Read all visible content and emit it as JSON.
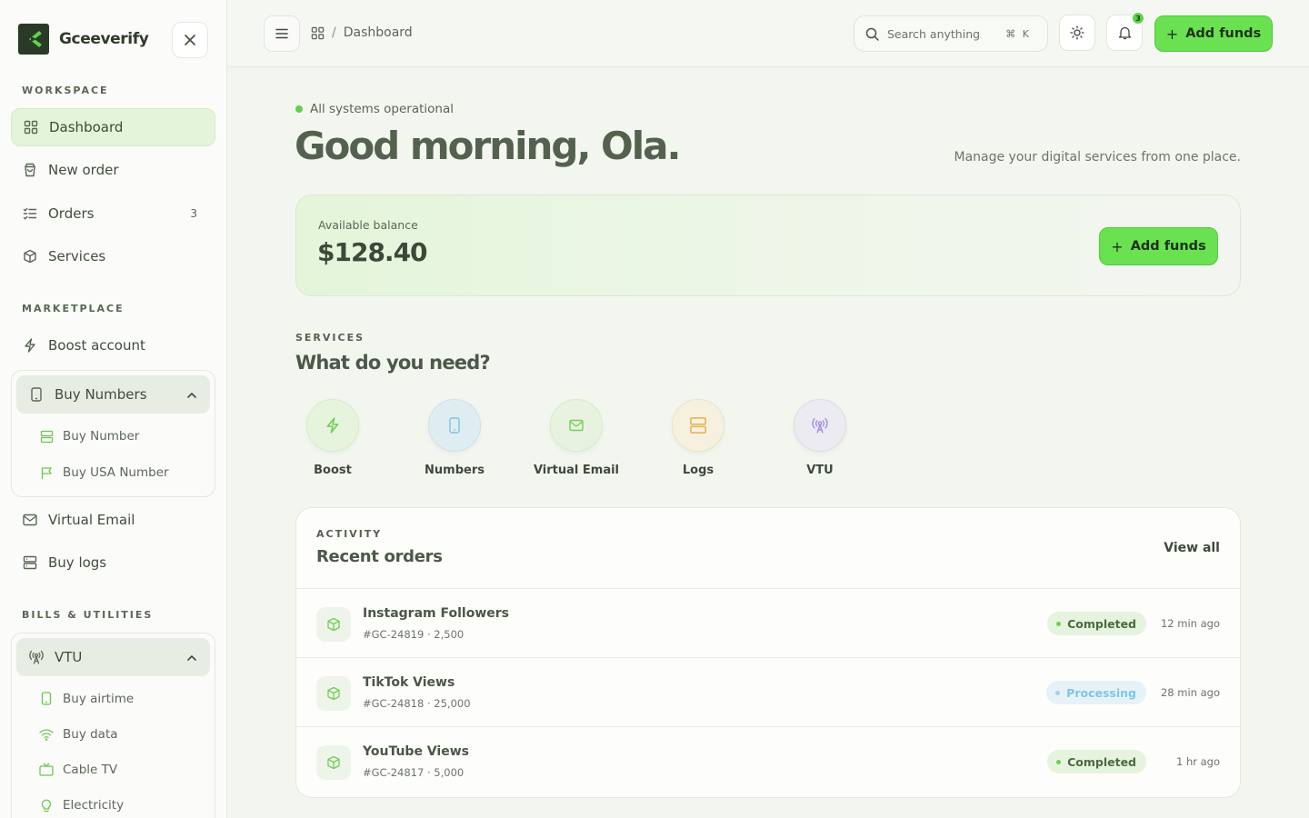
{
  "brand": {
    "name": "Gceeverify",
    "accent": "#6ae151",
    "dark": "#2a3a26"
  },
  "sidebar": {
    "sections": [
      {
        "label": "WORKSPACE"
      },
      {
        "label": "MARKETPLACE"
      },
      {
        "label": "BILLS & UTILITIES"
      }
    ],
    "workspace": [
      {
        "label": "Dashboard",
        "icon": "grid-icon",
        "active": true
      },
      {
        "label": "New order",
        "icon": "bag-icon"
      },
      {
        "label": "Orders",
        "icon": "list-check-icon",
        "count": "3"
      },
      {
        "label": "Services",
        "icon": "box-icon"
      }
    ],
    "marketplace": {
      "boost": {
        "label": "Boost account",
        "icon": "bolt-icon"
      },
      "buy_numbers": {
        "label": "Buy Numbers",
        "icon": "phone-icon",
        "expanded": true,
        "children": [
          {
            "label": "Buy Number",
            "icon": "server-icon"
          },
          {
            "label": "Buy USA Number",
            "icon": "flag-icon"
          }
        ]
      },
      "virtual_email": {
        "label": "Virtual Email",
        "icon": "mail-icon"
      },
      "buy_logs": {
        "label": "Buy logs",
        "icon": "database-icon"
      }
    },
    "bills": {
      "vtu": {
        "label": "VTU",
        "icon": "antenna-icon",
        "expanded": true,
        "children": [
          {
            "label": "Buy airtime",
            "icon": "phone-icon"
          },
          {
            "label": "Buy data",
            "icon": "wifi-icon"
          },
          {
            "label": "Cable TV",
            "icon": "tv-icon"
          },
          {
            "label": "Electricity",
            "icon": "bulb-icon"
          }
        ]
      }
    }
  },
  "header": {
    "breadcrumb": "Dashboard",
    "search": {
      "placeholder": "Search anything",
      "shortcut": "⌘ K"
    },
    "notifications_count": "3",
    "add_funds_label": "Add funds"
  },
  "main": {
    "status": "All systems operational",
    "greeting": "Good morning, Ola.",
    "tagline": "Manage your digital services from one place.",
    "balance": {
      "label": "Available balance",
      "amount": "$128.40",
      "add_funds_label": "Add funds"
    },
    "services": {
      "eyebrow": "SERVICES",
      "title": "What do you need?",
      "items": [
        {
          "label": "Boost",
          "icon": "bolt-icon",
          "bg": "#e6f4de",
          "fg": "#6fcf55"
        },
        {
          "label": "Numbers",
          "icon": "phone-icon",
          "bg": "#dfedf3",
          "fg": "#7cc3e0"
        },
        {
          "label": "Virtual Email",
          "icon": "mail-icon",
          "bg": "#e7f3df",
          "fg": "#74cf5c"
        },
        {
          "label": "Logs",
          "icon": "database-icon",
          "bg": "#f6f1df",
          "fg": "#e8b35c"
        },
        {
          "label": "VTU",
          "icon": "antenna-icon",
          "bg": "#ebebf1",
          "fg": "#a58be0"
        }
      ]
    },
    "activity": {
      "eyebrow": "ACTIVITY",
      "title": "Recent orders",
      "view_all": "View all",
      "orders": [
        {
          "name": "Instagram Followers",
          "meta": "#GC-24819 · 2,500",
          "status": "Completed",
          "time": "12 min ago"
        },
        {
          "name": "TikTok Views",
          "meta": "#GC-24818 · 25,000",
          "status": "Processing",
          "time": "28 min ago"
        },
        {
          "name": "YouTube Views",
          "meta": "#GC-24817 · 5,000",
          "status": "Completed",
          "time": "1 hr ago"
        }
      ]
    }
  }
}
